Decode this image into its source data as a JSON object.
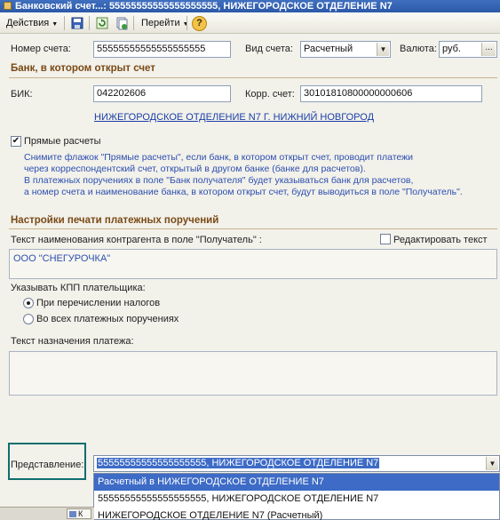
{
  "window": {
    "title": "Банковский счет...: 55555555555555555555, НИЖЕГОРОДСКОЕ ОТДЕЛЕНИЕ N7"
  },
  "toolbar": {
    "actions_label": "Действия",
    "goto_label": "Перейти",
    "help_label": "?"
  },
  "account": {
    "number_label": "Номер счета:",
    "number_value": "55555555555555555555",
    "type_label": "Вид счета:",
    "type_value": "Расчетный",
    "currency_label": "Валюта:",
    "currency_value": "руб.",
    "currency_button": "..."
  },
  "bank_section": {
    "title": "Банк, в котором открыт счет",
    "bik_label": "БИК:",
    "bik_value": "042202606",
    "corr_label": "Корр. счет:",
    "corr_value": "30101810800000000606",
    "bank_link": "НИЖЕГОРОДСКОЕ ОТДЕЛЕНИЕ N7 Г. НИЖНИЙ НОВГОРОД"
  },
  "direct": {
    "checkbox_label": "Прямые расчеты",
    "checked": true,
    "hint_lines": [
      "Снимите флажок \"Прямые расчеты\", если банк, в котором открыт счет, проводит платежи",
      "через корреспондентский счет, открытый в другом банке (банке для расчетов).",
      "В платежных поручениях в поле \"Банк получателя\" будет указываться банк для расчетов,",
      "а номер счета и наименование банка, в котором открыт счет, будут выводиться в поле \"Получатель\"."
    ]
  },
  "print_section": {
    "title": "Настройки печати платежных поручений",
    "recipient_label": "Текст наименования контрагента в поле \"Получатель\" :",
    "edit_text_label": "Редактировать текст",
    "recipient_text": "ООО \"СНЕГУРОЧКА\"",
    "kpp_label": "Указывать КПП плательщика:",
    "radio_taxes": "При перечислении налогов",
    "radio_all": "Во всех платежных поручениях",
    "purpose_label": "Текст назначения платежа:"
  },
  "presentation": {
    "label": "Представление:",
    "value": "55555555555555555555, НИЖЕГОРОДСКОЕ ОТДЕЛЕНИЕ N7",
    "options": [
      "Расчетный в НИЖЕГОРОДСКОЕ ОТДЕЛЕНИЕ N7",
      "55555555555555555555, НИЖЕГОРОДСКОЕ ОТДЕЛЕНИЕ N7",
      "НИЖЕГОРОДСКОЕ ОТДЕЛЕНИЕ N7 (Расчетный)"
    ],
    "selected_index": 0
  },
  "taskbar": {
    "item_label": "К"
  },
  "colors": {
    "section_title": "#7a4a16",
    "hint_text": "#2d4fb0",
    "link": "#1a3fa8",
    "selection": "#3d6bc6",
    "highlight_border": "#0f6e6e"
  }
}
